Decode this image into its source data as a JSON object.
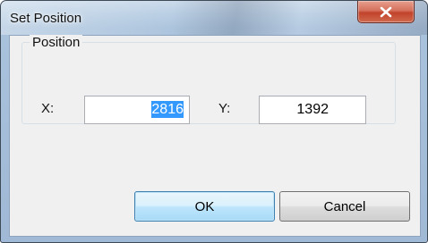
{
  "window": {
    "title": "Set Position",
    "close_icon": "close-icon"
  },
  "group": {
    "label": "Position"
  },
  "fields": {
    "x": {
      "label": "X:",
      "value": "2816",
      "selected": true
    },
    "y": {
      "label": "Y:",
      "value": "1392"
    }
  },
  "buttons": {
    "ok": "OK",
    "cancel": "Cancel"
  },
  "colors": {
    "selection": "#3399ff",
    "close_button": "#c1432b",
    "default_button_border": "#3c7fb1"
  }
}
